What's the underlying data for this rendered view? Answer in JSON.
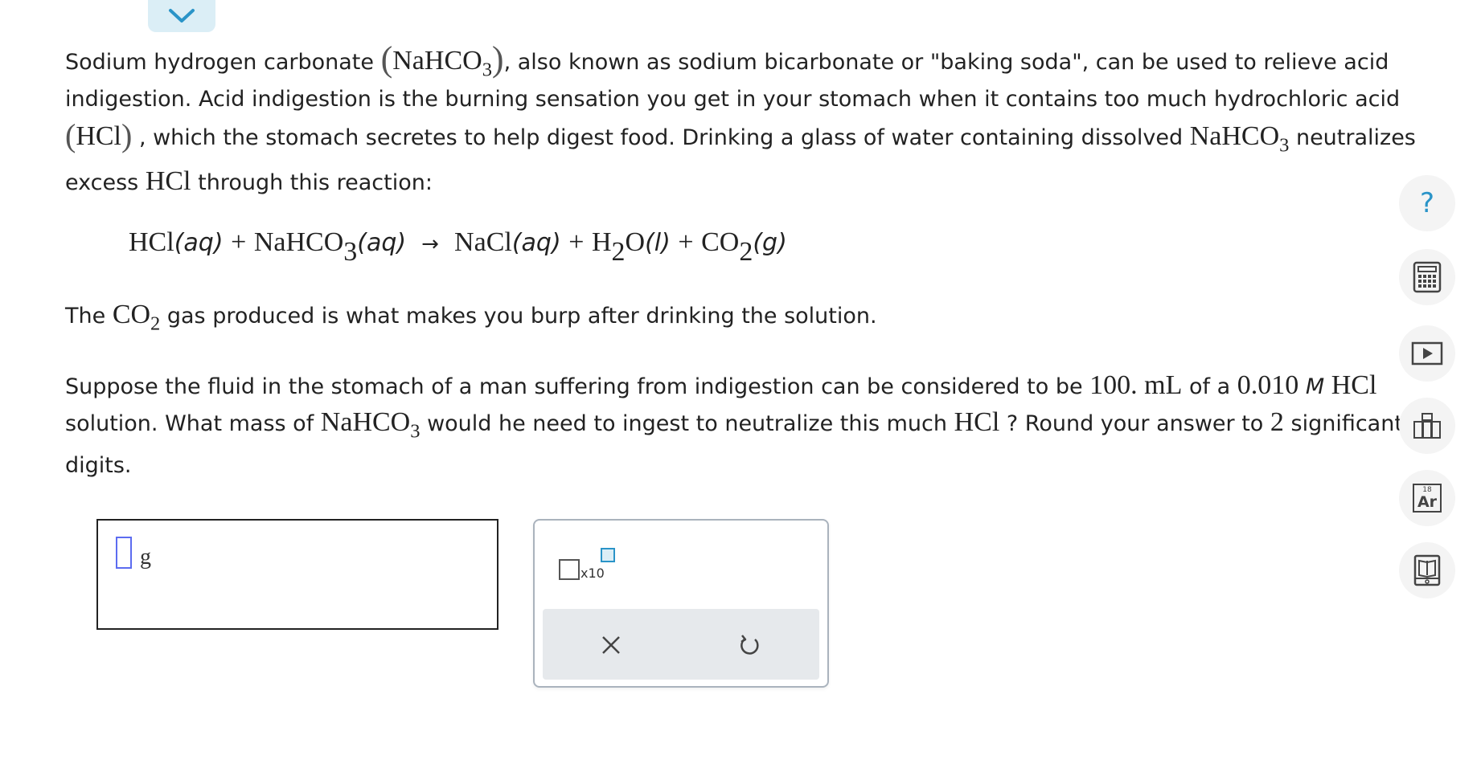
{
  "paragraph1": {
    "l1_a": "Sodium hydrogen carbonate",
    "nahco3_base": "NaHCO",
    "sub3": "3",
    "l1_b": ", also known as sodium bicarbonate or \"baking soda\", can be used to relieve acid",
    "l2": "indigestion. Acid indigestion is the burning sensation you get in your stomach when it contains too much hydrochloric acid",
    "hcl": "HCl",
    "l3_a": ", which the stomach secretes to help digest food. Drinking a glass of water containing dissolved",
    "l3_b": "neutralizes",
    "l4_a": "excess",
    "l4_b": "through this reaction:"
  },
  "equation": {
    "t1": "HCl",
    "aq": "(aq)",
    "plus": "+",
    "t2": "NaHCO",
    "arrow": "→",
    "t3": "NaCl",
    "t4_a": "H",
    "sub2": "2",
    "t4_b": "O",
    "l": "(l)",
    "t5": "CO",
    "g": "(g)"
  },
  "paragraph2": {
    "a": "The",
    "co": "CO",
    "b": "gas produced is what makes you burp after drinking the solution."
  },
  "paragraph3": {
    "l1_a": "Suppose the fluid in the stomach of a man suffering from indigestion can be considered to be",
    "volume": "100. mL",
    "of_a": "of a",
    "conc": "0.010",
    "M": "M",
    "hcl": "HCl",
    "l2_a": "solution. What mass of",
    "l2_b": "would he need to ingest to neutralize this much",
    "l2_c": "? Round your answer to",
    "sig": "2",
    "l2_d": "significant",
    "l3": "digits."
  },
  "answer": {
    "unit": "g"
  },
  "keypad": {
    "x10_label": "x10",
    "clear_symbol": "×",
    "undo_symbol": "↺"
  },
  "sidebar": {
    "help_symbol": "?",
    "periodic_number": "18",
    "periodic_symbol": "Ar"
  },
  "colors": {
    "accent_blue": "#2a94c8",
    "tab_bg": "#dbeef6",
    "cursor": "#5c6cf0",
    "keypad_bar": "#e6e9ec"
  }
}
